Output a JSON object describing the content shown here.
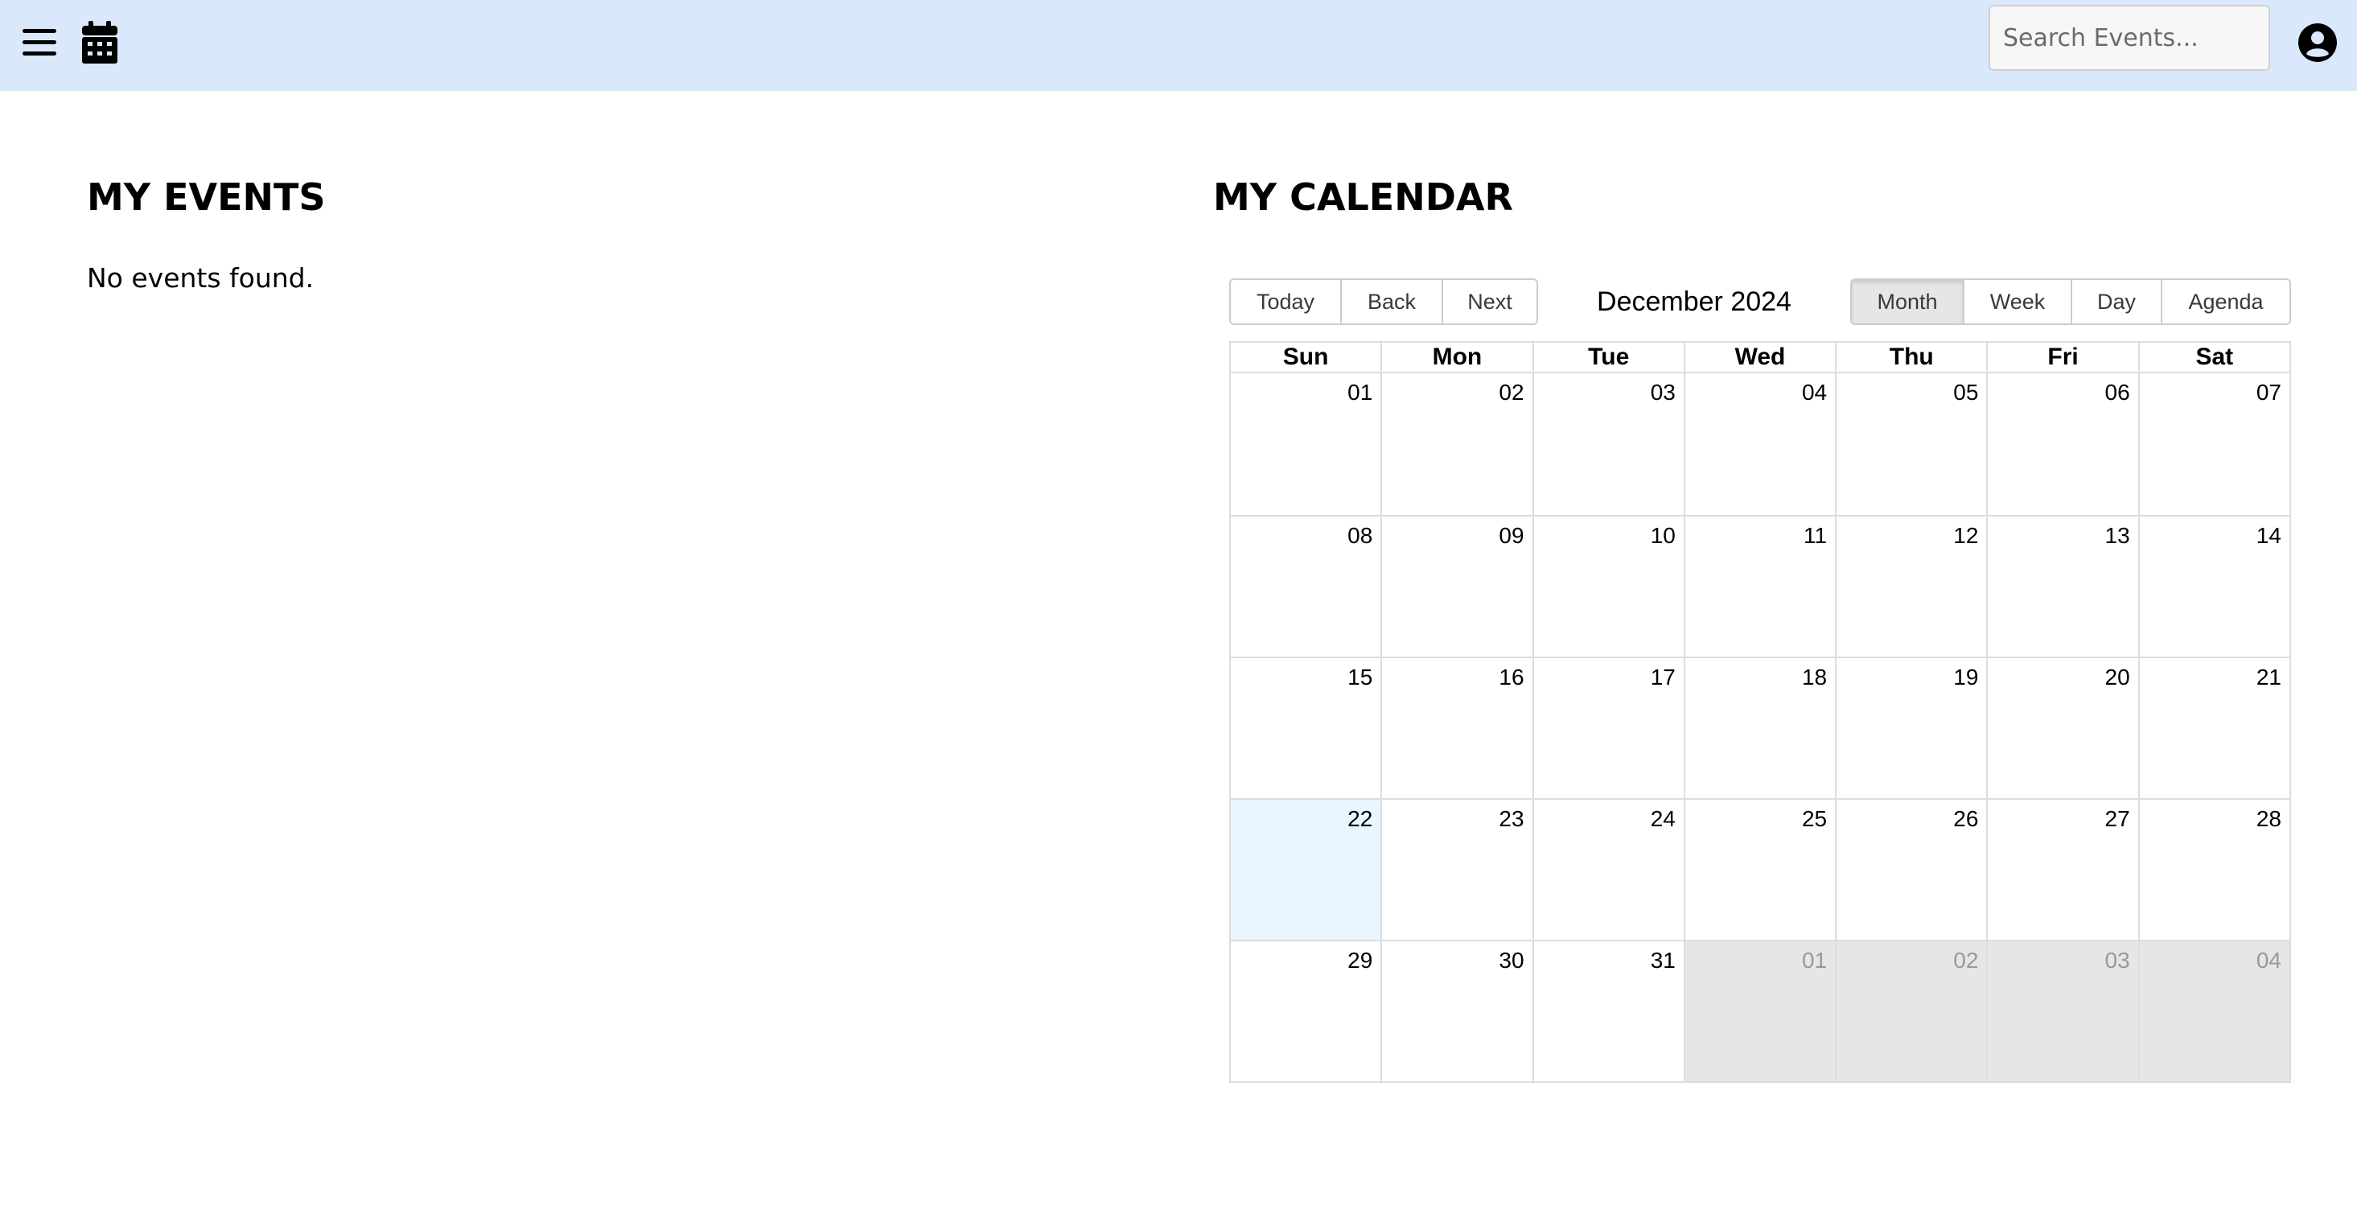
{
  "header": {
    "search_placeholder": "Search Events..."
  },
  "events": {
    "title": "MY EVENTS",
    "empty_text": "No events found."
  },
  "calendar": {
    "title": "MY CALENDAR",
    "nav_buttons": [
      "Today",
      "Back",
      "Next"
    ],
    "month_label": "December 2024",
    "view_buttons": [
      "Month",
      "Week",
      "Day",
      "Agenda"
    ],
    "active_view": "Month",
    "weekdays": [
      "Sun",
      "Mon",
      "Tue",
      "Wed",
      "Thu",
      "Fri",
      "Sat"
    ],
    "weeks": [
      [
        "01",
        "02",
        "03",
        "04",
        "05",
        "06",
        "07"
      ],
      [
        "08",
        "09",
        "10",
        "11",
        "12",
        "13",
        "14"
      ],
      [
        "15",
        "16",
        "17",
        "18",
        "19",
        "20",
        "21"
      ],
      [
        "22",
        "23",
        "24",
        "25",
        "26",
        "27",
        "28"
      ],
      [
        "29",
        "30",
        "31",
        "01",
        "02",
        "03",
        "04"
      ]
    ],
    "today_date": "22",
    "colors": {
      "topbar_bg": "#d9e9fb",
      "today_bg": "#eaf6ff",
      "off_range_bg": "#e6e6e6",
      "active_button_bg": "#e6e6e6"
    }
  }
}
